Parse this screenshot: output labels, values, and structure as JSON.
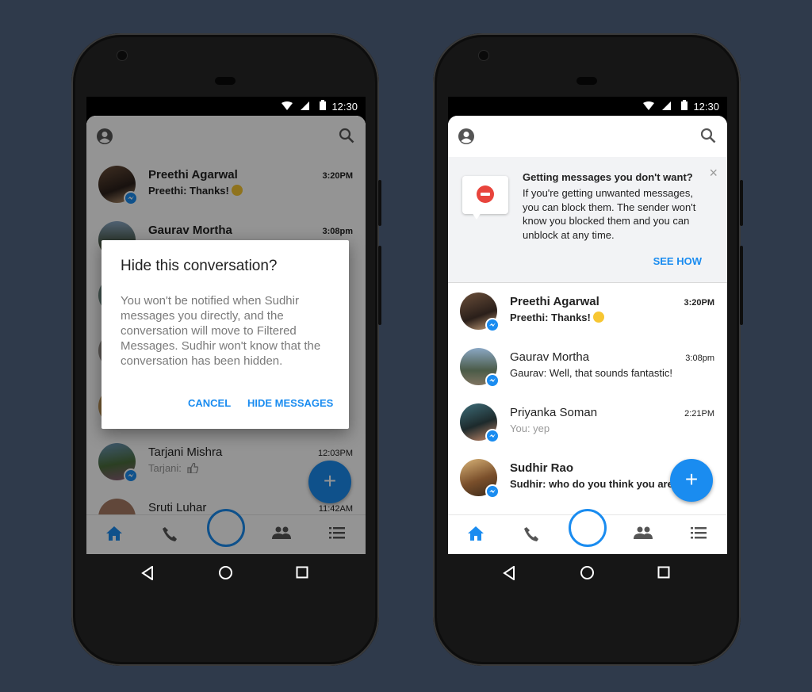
{
  "status_bar": {
    "time": "12:30"
  },
  "left_phone": {
    "conversations": [
      {
        "name": "Preethi Agarwal",
        "preview": "Preethi: Thanks!",
        "time": "3:20PM"
      },
      {
        "name": "Gaurav Mortha",
        "preview": "",
        "time": "3:08pm"
      },
      {
        "name": "Tarjani Mishra",
        "preview": "Tarjani:",
        "time": "12:03PM"
      },
      {
        "name": "Sruti Luhar",
        "preview": "",
        "time": "11:42AM"
      }
    ],
    "dialog": {
      "title": "Hide this conversation?",
      "body": "You won't be notified when Sudhir messages you directly, and the conversation will move to Filtered Messages. Sudhir won't know that the conversation has been hidden.",
      "cancel": "CANCEL",
      "confirm": "HIDE MESSAGES"
    },
    "fab": "+"
  },
  "right_phone": {
    "banner": {
      "title": "Getting messages you don't want?",
      "body": "If you're getting unwanted messages, you can block them. The sender won't know you blocked them and you can unblock at any time.",
      "action": "SEE HOW",
      "close": "×"
    },
    "conversations": [
      {
        "name": "Preethi Agarwal",
        "preview": "Preethi: Thanks!",
        "time": "3:20PM"
      },
      {
        "name": "Gaurav Mortha",
        "preview": "Gaurav: Well, that sounds fantastic!",
        "time": "3:08pm"
      },
      {
        "name": "Priyanka Soman",
        "preview": "You: yep",
        "time": "2:21PM"
      },
      {
        "name": "Sudhir Rao",
        "preview": "Sudhir: who do you think you are?",
        "time": ""
      }
    ],
    "fab": "+"
  },
  "icons": [
    "profile-icon",
    "search-icon",
    "home-icon",
    "phone-icon",
    "camera-icon",
    "people-icon",
    "list-icon",
    "back-icon",
    "home-nav-icon",
    "recents-icon",
    "messenger-badge-icon",
    "block-icon",
    "close-icon",
    "thumbs-up-icon",
    "wifi-icon",
    "signal-icon",
    "battery-icon"
  ],
  "colors": {
    "accent": "#1a8cf0",
    "background": "#2f3a4b",
    "block_red": "#e8443c",
    "banner_bg": "#f2f3f5"
  }
}
